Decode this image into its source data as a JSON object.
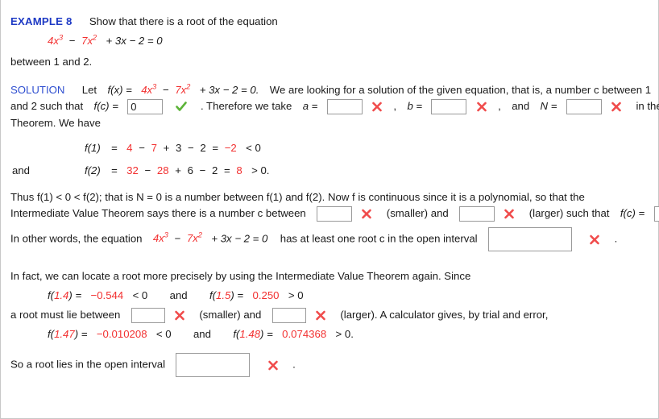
{
  "example": {
    "label": "EXAMPLE 8",
    "prompt": "Show that there is a root of the equation",
    "equation": {
      "a_coeff": "4x",
      "a_exp": "3",
      "minus": "−",
      "b_coeff": "7x",
      "b_exp": "2",
      "rest": "+ 3x − 2 = 0"
    },
    "range_text": "between 1 and 2."
  },
  "solution": {
    "label": "SOLUTION",
    "let_text": "Let",
    "fx": "f(x) =",
    "fx_red_a": "4x",
    "fx_red_a_exp": "3",
    "fx_minus": "−",
    "fx_red_b": "7x",
    "fx_red_b_exp": "2",
    "fx_rest": "+ 3x − 2 = 0.",
    "looking_text": "We are looking for a solution of the given equation, that is, a number c between 1",
    "line2_pre": "and 2 such that",
    "fc_label": "f(c) =",
    "fc_value": "0",
    "fc_status": "correct",
    "therefore_text": ". Therefore we take",
    "a_label": "a =",
    "a_value": "",
    "a_status": "incorrect",
    "comma1": ",",
    "b_label": "b =",
    "b_value": "",
    "b_status": "incorrect",
    "comma2": ",",
    "and_text": "and",
    "N_label": "N =",
    "N_value": "",
    "N_status": "incorrect",
    "ivt_text": "in the Intermediate Value",
    "line3": "Theorem. We have"
  },
  "evaluations": {
    "f1": {
      "lhs": "f(1)",
      "eq": "=",
      "t1": "4",
      "op1": "−",
      "t2": "7",
      "op2": "+",
      "t3": "3",
      "op3": "−",
      "t4": "2",
      "eq2": "=",
      "result": "−2",
      "compare": "< 0"
    },
    "and_label": "and",
    "f2": {
      "lhs": "f(2)",
      "eq": "=",
      "t1": "32",
      "op1": "−",
      "t2": "28",
      "op2": "+",
      "t3": "6",
      "op3": "−",
      "t4": "2",
      "eq2": "=",
      "result": "8",
      "compare": "> 0."
    }
  },
  "thus": {
    "line1": "Thus  f(1) < 0 < f(2);  that is N = 0 is a number between  f(1)  and  f(2).  Now f is continuous since it is a polynomial, so that the",
    "line2_pre": "Intermediate Value Theorem says there is a number c between",
    "smaller_value": "",
    "smaller_status": "incorrect",
    "smaller_label": "(smaller) and",
    "larger_value": "",
    "larger_status": "incorrect",
    "larger_label": "(larger) such that",
    "fc_label": "f(c) =",
    "fc_value": "",
    "fc_status": "incorrect",
    "period": "."
  },
  "in_other_words": {
    "pre": "In other words, the equation",
    "eq_a": "4x",
    "eq_a_exp": "3",
    "eq_minus": "−",
    "eq_b": "7x",
    "eq_b_exp": "2",
    "eq_rest": "+ 3x − 2 = 0",
    "post": "has at least one root c in the open interval",
    "interval_value": "",
    "interval_status": "incorrect",
    "period": "."
  },
  "in_fact": {
    "line1": "In fact, we can locate a root more precisely by using the Intermediate Value Theorem again. Since",
    "f14": {
      "f": "f(",
      "arg": "1.4",
      "close": ") =",
      "value": "−0.544",
      "compare": "< 0"
    },
    "and_label": "and",
    "f15": {
      "f": "f(",
      "arg": "1.5",
      "close": ") =",
      "value": "0.250",
      "compare": "> 0"
    },
    "between_pre": "a root must lie between",
    "smaller_value": "",
    "smaller_status": "incorrect",
    "smaller_label": "(smaller) and",
    "larger_value": "",
    "larger_status": "incorrect",
    "larger_label": "(larger). A calculator gives, by trial and error,",
    "f147": {
      "f": "f(",
      "arg": "1.47",
      "close": ") =",
      "value": "−0.010208",
      "compare": "< 0"
    },
    "and_label2": "and",
    "f148": {
      "f": "f(",
      "arg": "1.48",
      "close": ") =",
      "value": "0.074368",
      "compare": "> 0."
    }
  },
  "conclusion": {
    "pre": "So a root lies in the open interval",
    "interval_value": "",
    "interval_status": "incorrect",
    "period": "."
  },
  "colors": {
    "red": "#f23030",
    "blue_heading": "#1d39c4",
    "blue_solution": "#2f4fd0",
    "mark_incorrect": "#f04b4b",
    "mark_correct": "#5cb338",
    "text": "#1a1a1a",
    "box_border": "#9a9a9a"
  }
}
